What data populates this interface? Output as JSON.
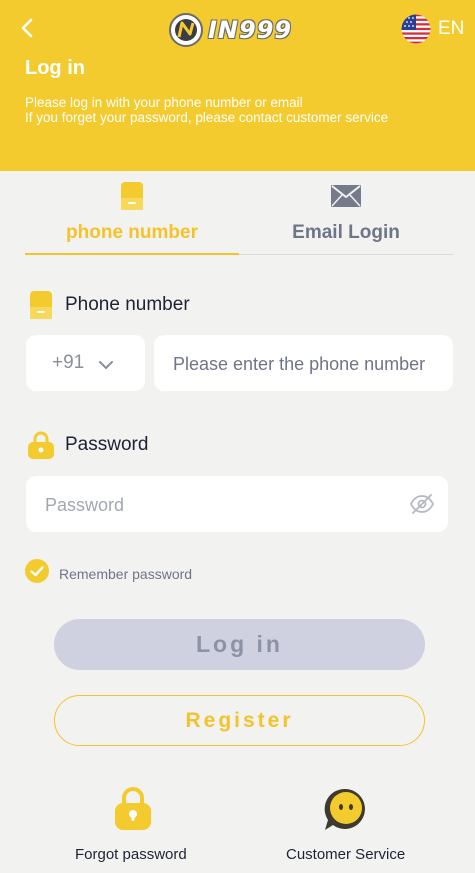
{
  "header": {
    "brand": "IN999",
    "language": "EN",
    "title": "Log in",
    "hint_line1": "Please log in with your phone number or email",
    "hint_line2": "If you forget your password, please contact customer service"
  },
  "tabs": [
    {
      "label": "phone number",
      "icon": "phone-icon",
      "active": true
    },
    {
      "label": "Email Login",
      "icon": "envelope-icon",
      "active": false
    }
  ],
  "phone": {
    "label": "Phone number",
    "country_code": "+91",
    "placeholder": "Please enter the phone number"
  },
  "password": {
    "label": "Password",
    "placeholder": "Password"
  },
  "remember": {
    "label": "Remember password",
    "checked": true
  },
  "buttons": {
    "login": "Log in",
    "register": "Register"
  },
  "bottom": {
    "forgot": "Forgot password",
    "service": "Customer Service"
  },
  "colors": {
    "accent": "#f4cb2f",
    "background": "#f2f2f1",
    "text_dark": "#1e2334",
    "text_muted": "#6f7588",
    "login_button": "#d0d1e0"
  }
}
